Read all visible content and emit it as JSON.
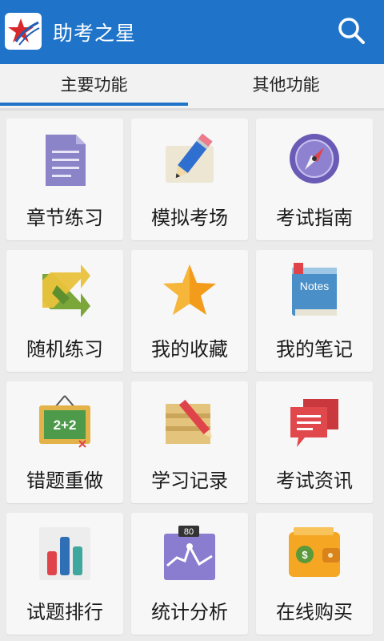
{
  "app_bar": {
    "title": "助考之星",
    "logo_icon": "star-logo-icon",
    "search_icon": "search-icon",
    "color": "#1f74c9"
  },
  "tabs": [
    {
      "label": "主要功能",
      "active": true
    },
    {
      "label": "其他功能",
      "active": false
    }
  ],
  "tiles": [
    {
      "label": "章节练习",
      "icon": "document-icon"
    },
    {
      "label": "模拟考场",
      "icon": "pencil-icon"
    },
    {
      "label": "考试指南",
      "icon": "compass-icon"
    },
    {
      "label": "随机练习",
      "icon": "shuffle-icon"
    },
    {
      "label": "我的收藏",
      "icon": "star-icon"
    },
    {
      "label": "我的笔记",
      "icon": "notes-icon",
      "icon_text": "Notes"
    },
    {
      "label": "错题重做",
      "icon": "chalkboard-icon",
      "icon_text": "2+2"
    },
    {
      "label": "学习记录",
      "icon": "scroll-icon"
    },
    {
      "label": "考试资讯",
      "icon": "chat-icon"
    },
    {
      "label": "试题排行",
      "icon": "bar-chart-icon"
    },
    {
      "label": "统计分析",
      "icon": "line-chart-icon",
      "icon_text": "80"
    },
    {
      "label": "在线购买",
      "icon": "wallet-icon"
    }
  ]
}
